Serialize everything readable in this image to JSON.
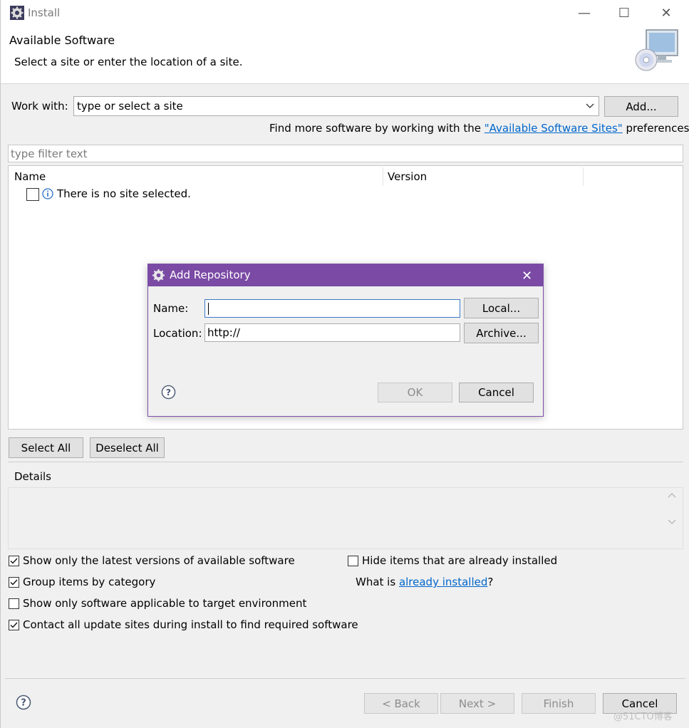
{
  "window": {
    "title": "Install",
    "minimize_label": "—",
    "maximize_label": "☐",
    "close_label": "✕"
  },
  "banner": {
    "title": "Available Software",
    "subtitle": "Select a site or enter the location of a site."
  },
  "work_with": {
    "label": "Work with:",
    "value": "type or select a site",
    "add_label": "Add...",
    "find_more_prefix": "Find more software by working with the ",
    "find_more_link": "\"Available Software Sites\"",
    "find_more_suffix": " preferences."
  },
  "filter": {
    "placeholder": "type filter text"
  },
  "table": {
    "columns": [
      "Name",
      "Version"
    ],
    "rows": [
      {
        "checked": false,
        "icon": "info-icon",
        "text": "There is no site selected."
      }
    ]
  },
  "selection_buttons": {
    "select_all": "Select All",
    "deselect_all": "Deselect All"
  },
  "details": {
    "label": "Details"
  },
  "options": {
    "latest_versions": {
      "label": "Show only the latest versions of available software",
      "checked": true
    },
    "group_by_category": {
      "label": "Group items by category",
      "checked": true
    },
    "target_environment": {
      "label": "Show only software applicable to target environment",
      "checked": false
    },
    "contact_update_sites": {
      "label": "Contact all update sites during install to find required software",
      "checked": true
    },
    "hide_installed": {
      "label": "Hide items that are already installed",
      "checked": false
    },
    "what_is_prefix": "What is ",
    "already_installed_link": "already installed",
    "what_is_suffix": "?"
  },
  "footer": {
    "back": "< Back",
    "next": "Next >",
    "finish": "Finish",
    "cancel": "Cancel"
  },
  "dialog": {
    "title": "Add Repository",
    "close_label": "✕",
    "name_label": "Name:",
    "name_value": "",
    "location_label": "Location:",
    "location_value": "http://",
    "local_button": "Local...",
    "archive_button": "Archive...",
    "ok_button": "OK",
    "cancel_button": "Cancel"
  },
  "watermark": "@51CTO博客",
  "colors": {
    "dialog_titlebar": "#7a4aa5",
    "link": "#0066cc",
    "disabled_text": "#8c8c8c"
  }
}
